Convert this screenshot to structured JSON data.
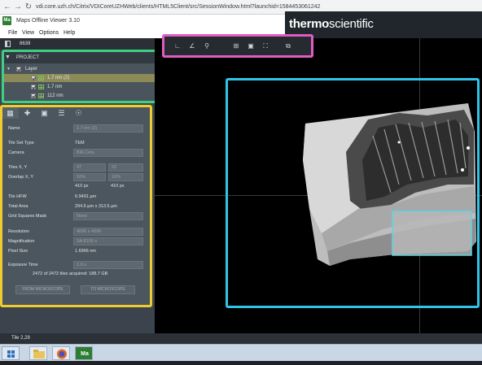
{
  "browser": {
    "back": "←",
    "forward": "→",
    "reload": "↻",
    "url": "vdi.core.uzh.ch/Citrix/VDICoreUZHWeb/clients/HTML5Client/src/SessionWindow.html?launchid=1584453061242"
  },
  "app": {
    "icon_text": "Ma",
    "title": "Maps Offline Viewer 3.10",
    "menu": [
      "File",
      "View",
      "Options",
      "Help"
    ],
    "brand_bold": "thermo",
    "brand_light": "scientific"
  },
  "sidebar": {
    "id_label": "8639",
    "project_label": "PROJECT",
    "tree": [
      {
        "label": "Layer",
        "selected": false
      },
      {
        "label": "1.7 nm (2)",
        "selected": true
      },
      {
        "label": "1.7 nm",
        "selected": false
      },
      {
        "label": "112 nm",
        "selected": false
      }
    ]
  },
  "properties": {
    "name_label": "Name",
    "name_value": "1.7 nm (2)",
    "tile_set_type_label": "Tile Set Type",
    "tile_set_type_value": "TEM",
    "camera_label": "Camera",
    "camera_value": "BM-Ceta",
    "tiles_label": "Tiles X, Y",
    "tiles_x": "47",
    "tiles_y": "52",
    "overlap_label": "Overlap X, Y",
    "overlap_x": "10%",
    "overlap_y": "10%",
    "overlap_px_x": "410 px",
    "overlap_px_y": "410 px",
    "tile_hfw_label": "Tile HFW",
    "tile_hfw_value": "6.9491 µm",
    "total_area_label": "Total Area",
    "total_area_value": "294.6 µm x 313.5 µm",
    "grid_mask_label": "Grid Squares Mask",
    "grid_mask_value": "None",
    "resolution_label": "Resolution",
    "resolution_value": "4096 x 4096",
    "magnification_label": "Magnification",
    "magnification_value": "SA 8100 x",
    "pixel_size_label": "Pixel Size",
    "pixel_size_value": "1.6966 nm",
    "exposure_label": "Exposure Time",
    "exposure_value": "1.0 s",
    "acquired_text": "2472 of 2472 tiles acquired: 188.7 GB",
    "from_microscope": "FROM MICROSCOPE",
    "to_microscope": "TO MICROSCOPE"
  },
  "status": {
    "text": "Tile 2,28"
  },
  "colors": {
    "project_highlight": "#3ecf82",
    "properties_highlight": "#f0cc2e",
    "toolbar_highlight": "#e25bc3",
    "viewer_highlight": "#2ec5e8"
  }
}
